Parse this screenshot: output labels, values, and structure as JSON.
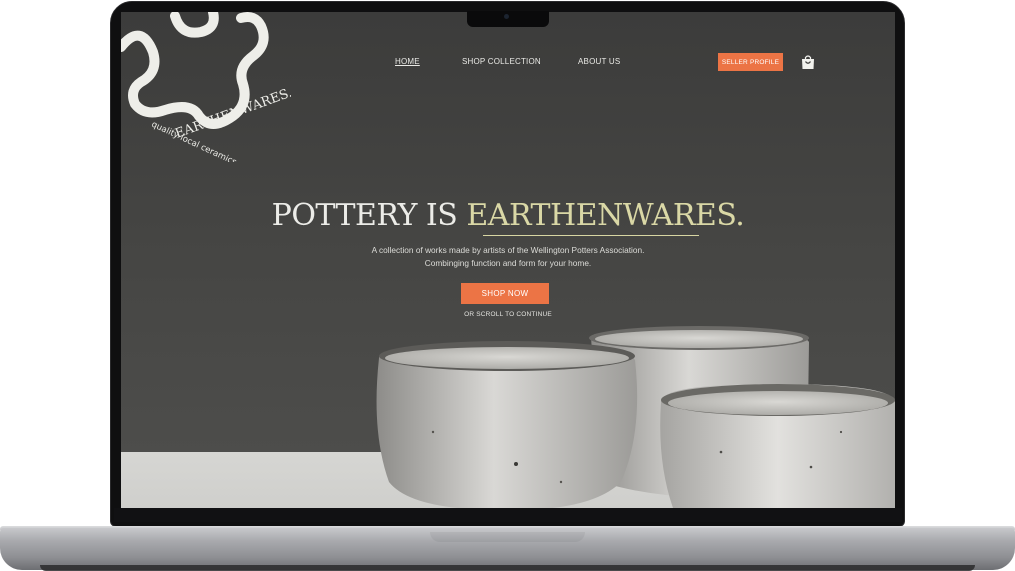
{
  "brand": {
    "name": "EARTHENWARES.",
    "tagline": "quality local ceramics"
  },
  "nav": {
    "home": "HOME",
    "shop": "SHOP COLLECTION",
    "about": "ABOUT US",
    "seller": "SELLER PROFILE"
  },
  "hero": {
    "title_prefix": "POTTERY IS",
    "title_accent": "EARTHENWARES.",
    "subtitle_line1": "A collection of works made by artists of the Wellington Potters Association.",
    "subtitle_line2": "Combinging function and form for your home.",
    "cta": "SHOP NOW",
    "scroll_hint": "OR SCROLL TO CONTINUE"
  },
  "icons": {
    "bag": "shopping-bag-icon",
    "logo": "flower-swirl-logo"
  },
  "colors": {
    "accent": "#ec7445",
    "title_accent": "#dad8a6",
    "background": "#454543"
  }
}
